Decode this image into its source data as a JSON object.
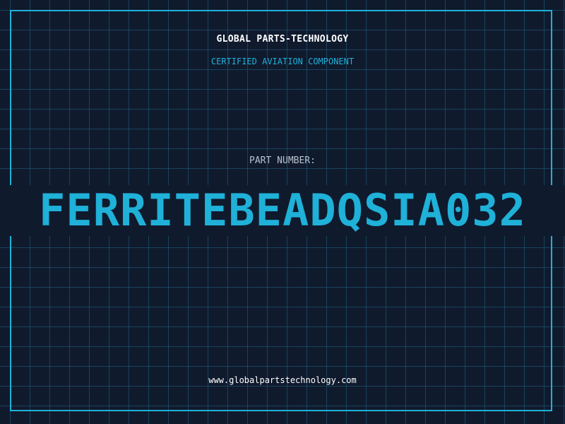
{
  "header": {
    "company": "GLOBAL PARTS-TECHNOLOGY",
    "subtitle": "CERTIFIED AVIATION COMPONENT"
  },
  "part": {
    "label": "PART NUMBER:",
    "number": "FERRITEBEADQSIA032"
  },
  "footer": {
    "website": "www.globalpartstechnology.com"
  },
  "colors": {
    "background": "#101a2d",
    "accent": "#1fb1d8",
    "grid": "#1e6482",
    "text": "#ffffff",
    "label": "#b8c2cf"
  }
}
